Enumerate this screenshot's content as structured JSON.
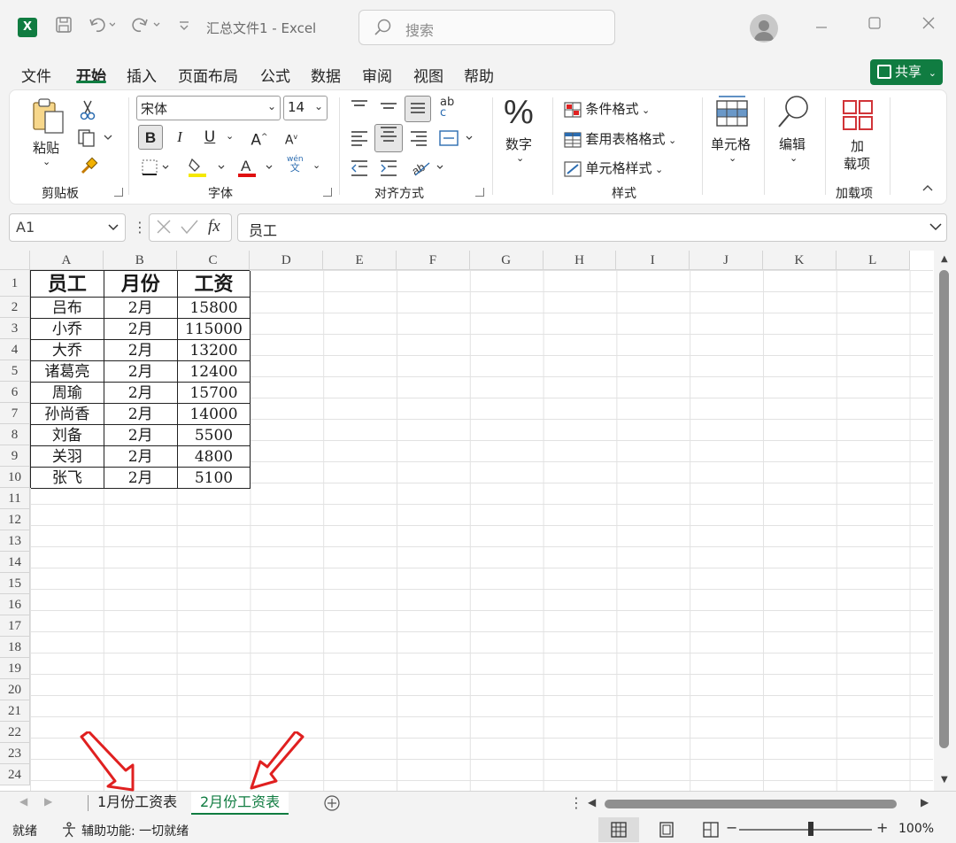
{
  "titlebar": {
    "app_icon": "X",
    "doc_title": "汇总文件1  -  Excel",
    "search_placeholder": "搜索"
  },
  "menu": {
    "tabs": [
      "文件",
      "开始",
      "插入",
      "页面布局",
      "公式",
      "数据",
      "审阅",
      "视图",
      "帮助"
    ],
    "active": "开始",
    "share_label": "共享"
  },
  "ribbon": {
    "clipboard": {
      "paste_label": "粘贴",
      "group_label": "剪贴板"
    },
    "font": {
      "font_name": "宋体",
      "font_size": "14",
      "group_label": "字体",
      "bold": "B",
      "italic": "I",
      "underline": "U",
      "grow": "A",
      "shrink": "A",
      "phonetic_top": "wén",
      "phonetic_bottom": "文"
    },
    "alignment": {
      "group_label": "对齐方式",
      "wrap_top": "ab",
      "wrap_bottom": "c"
    },
    "number": {
      "icon": "%",
      "label": "数字"
    },
    "styles": {
      "conditional": "条件格式",
      "table": "套用表格格式",
      "cell_styles": "单元格样式",
      "group_label": "样式"
    },
    "cells": {
      "label": "单元格"
    },
    "editing": {
      "label": "编辑"
    },
    "addins": {
      "label_line1": "加",
      "label_line2": "载项",
      "group_label": "加载项"
    }
  },
  "formula_bar": {
    "name_box": "A1",
    "fx": "fx",
    "value": "员工"
  },
  "grid": {
    "columns": [
      "A",
      "B",
      "C",
      "D",
      "E",
      "F",
      "G",
      "H",
      "I",
      "J",
      "K",
      "L"
    ],
    "rows": [
      "1",
      "2",
      "3",
      "4",
      "5",
      "6",
      "7",
      "8",
      "9",
      "10",
      "11",
      "12",
      "13",
      "14",
      "15",
      "16",
      "17",
      "18",
      "19",
      "20",
      "21",
      "22",
      "23",
      "24"
    ],
    "table": {
      "headers": [
        "员工",
        "月份",
        "工资"
      ],
      "rows": [
        [
          "吕布",
          "2月",
          "15800"
        ],
        [
          "小乔",
          "2月",
          "115000"
        ],
        [
          "大乔",
          "2月",
          "13200"
        ],
        [
          "诸葛亮",
          "2月",
          "12400"
        ],
        [
          "周瑜",
          "2月",
          "15700"
        ],
        [
          "孙尚香",
          "2月",
          "14000"
        ],
        [
          "刘备",
          "2月",
          "5500"
        ],
        [
          "关羽",
          "2月",
          "4800"
        ],
        [
          "张飞",
          "2月",
          "5100"
        ]
      ]
    }
  },
  "sheet_tabs": {
    "tabs": [
      "1月份工资表",
      "2月份工资表"
    ],
    "active": "2月份工资表"
  },
  "status": {
    "ready": "就绪",
    "accessibility": "辅助功能: 一切就绪",
    "zoom": "100%"
  },
  "colors": {
    "accent": "#107c41",
    "arrow": "#e02020"
  }
}
